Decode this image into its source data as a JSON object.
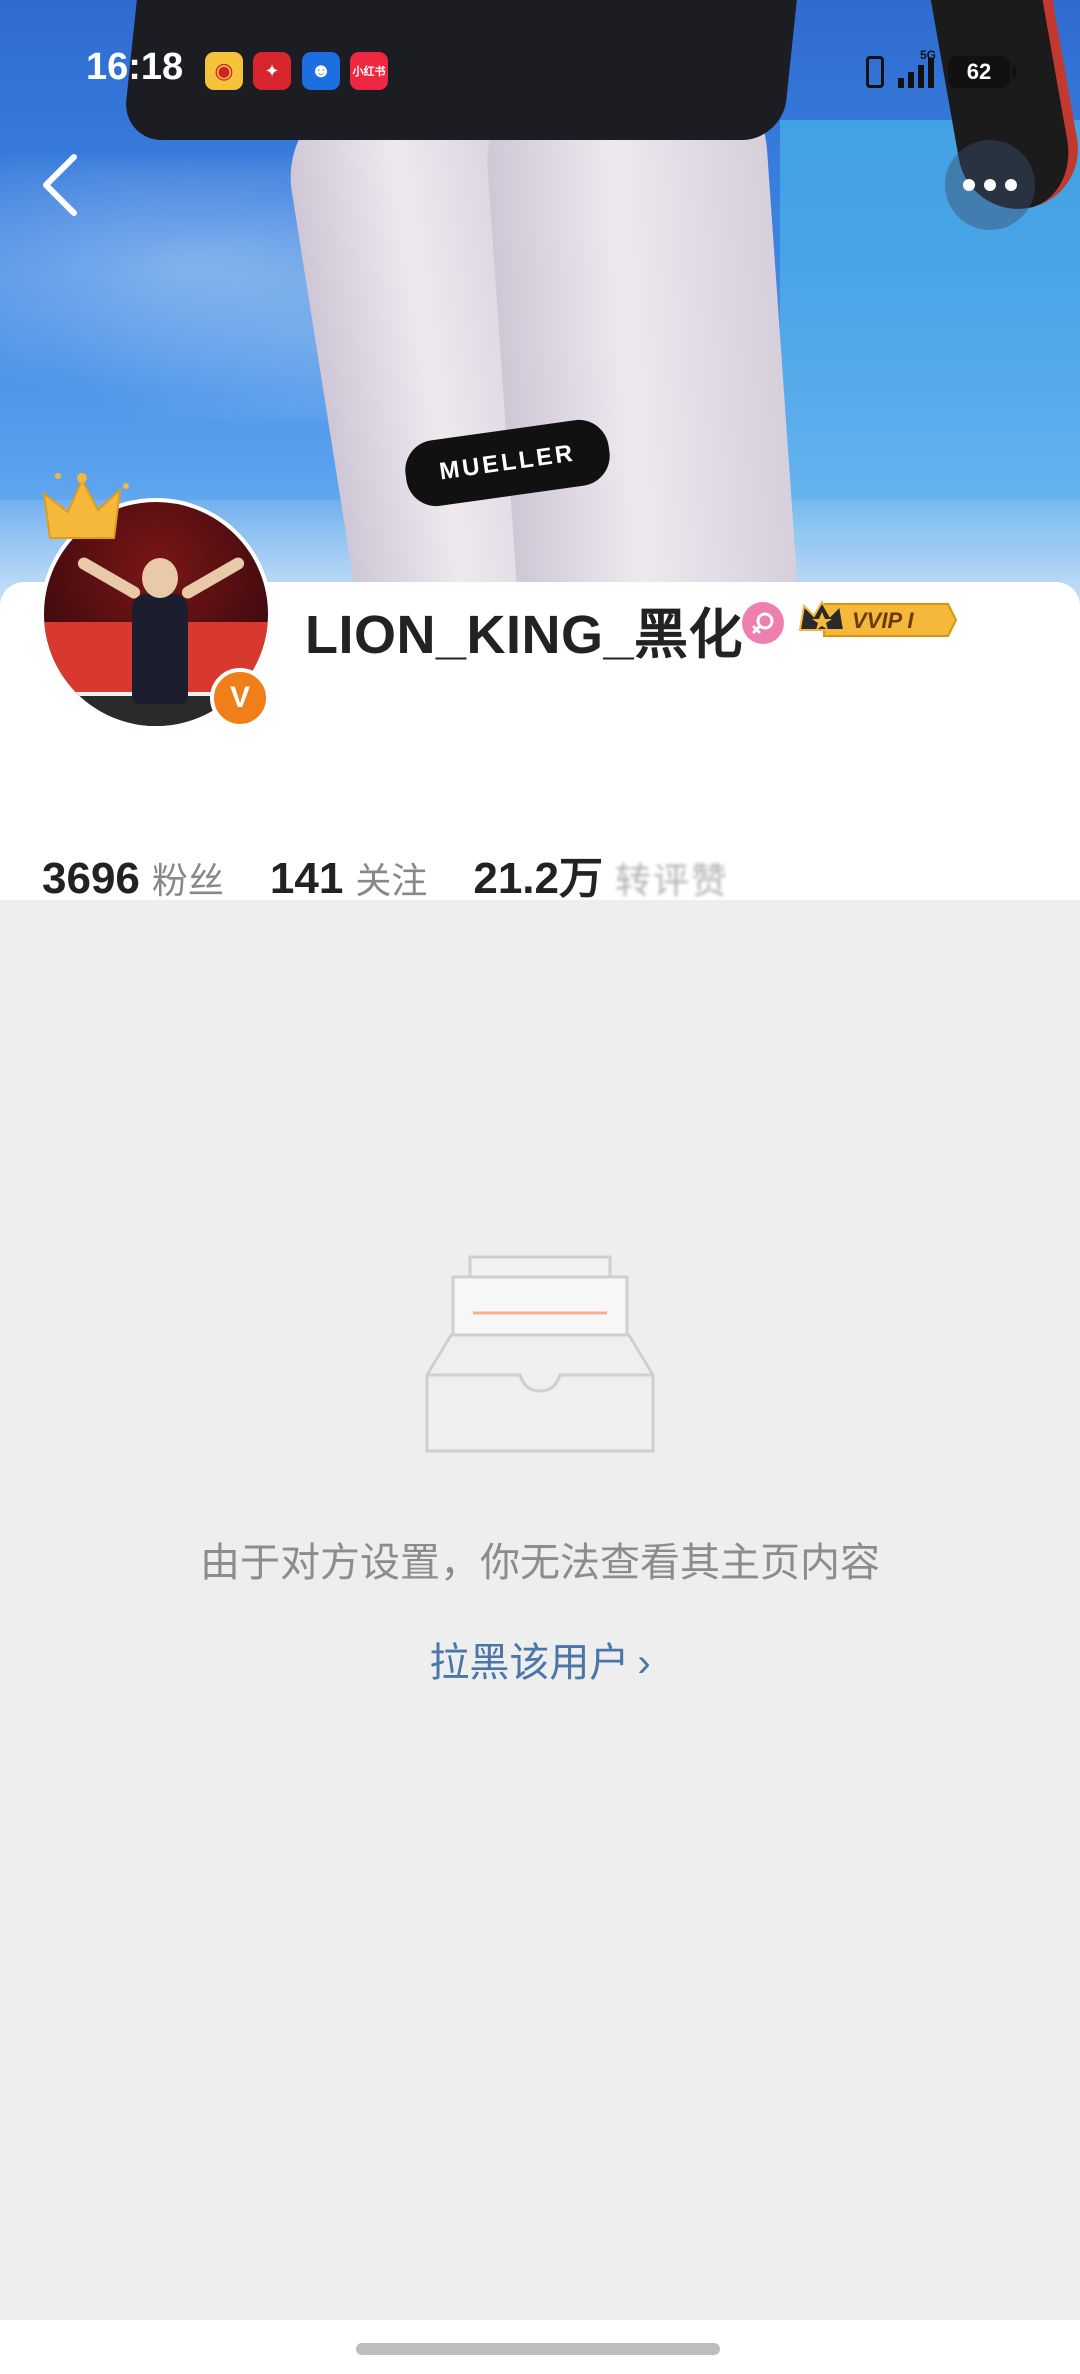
{
  "status_bar": {
    "time": "16:18",
    "apps": [
      "weibo-icon",
      "pinduoduo-icon",
      "qq-icon",
      "xiaohongshu-icon"
    ],
    "xhs_label": "小红书",
    "network": "5G",
    "battery": "62"
  },
  "cover": {
    "knee_band_text": "MUELLER"
  },
  "profile": {
    "username": "LION_KING_黑化",
    "gender": "female",
    "vip_label": "VVIP I",
    "verified_mark": "V",
    "stats": [
      {
        "value": "3696",
        "label": "粉丝"
      },
      {
        "value": "141",
        "label": "关注"
      },
      {
        "value": "21.2万",
        "label": "转评赞"
      }
    ]
  },
  "empty_state": {
    "message": "由于对方设置，你无法查看其主页内容",
    "block_link": "拉黑该用户",
    "block_link_chevron": "›"
  },
  "colors": {
    "accent_link": "#4a77a8",
    "verified_orange": "#f07f1a",
    "gender_pink": "#f07fb1",
    "vip_gold": "#f5b83b",
    "background": "#eeeeee"
  }
}
